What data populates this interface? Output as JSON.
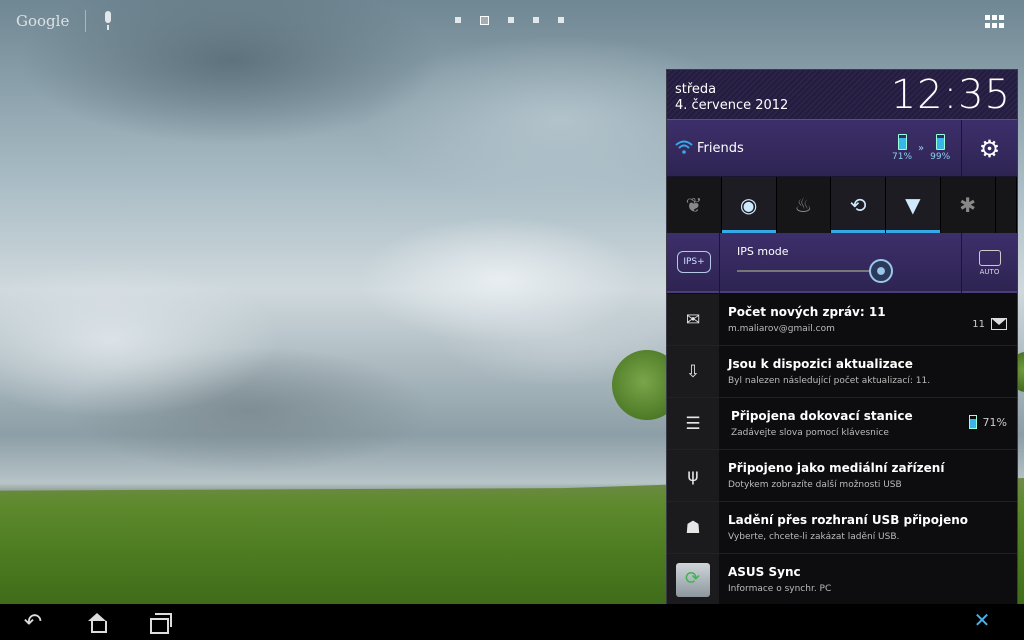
{
  "launcher": {
    "google_label": "Google",
    "page_count": 5,
    "active_page": 2
  },
  "panel": {
    "day": "středa",
    "date": "4. července 2012",
    "time": "12:35",
    "wifi_label": "Friends",
    "battery_tablet": "71%",
    "battery_dock": "99%",
    "battery_separator": "»",
    "toggles": [
      {
        "name": "eco-icon",
        "glyph": "❦",
        "on": false
      },
      {
        "name": "balanced-mode-icon",
        "glyph": "◉",
        "on": true
      },
      {
        "name": "performance-flame-icon",
        "glyph": "♨",
        "on": false
      },
      {
        "name": "auto-rotate-icon",
        "glyph": "⟲",
        "on": true
      },
      {
        "name": "wifi-toggle-icon",
        "glyph": "▼",
        "on": true
      },
      {
        "name": "bluetooth-icon",
        "glyph": "✱",
        "on": false
      }
    ],
    "ips_icon_label": "IPS+",
    "ips_label": "IPS mode",
    "ips_level": 0.9,
    "auto_label": "AUTO"
  },
  "notifications": [
    {
      "title": "Počet nových zpráv: 11",
      "subtitle": "m.maliarov@gmail.com",
      "right": "11",
      "icon": "gmail-icon"
    },
    {
      "title": "Jsou k dispozici aktualizace",
      "subtitle": "Byl nalezen následující počet aktualizací: 11.",
      "right": "",
      "icon": "update-bag-icon"
    },
    {
      "title": "Připojena dokovací stanice",
      "subtitle": "Zadávejte slova pomocí klávesnice",
      "right": "71%",
      "icon": "dock-icon"
    },
    {
      "title": "Připojeno jako mediální zařízení",
      "subtitle": "Dotykem zobrazíte další možnosti USB",
      "right": "",
      "icon": "usb-icon"
    },
    {
      "title": "Ladění přes rozhraní USB připojeno",
      "subtitle": "Vyberte, chcete-li zakázat ladění USB.",
      "right": "",
      "icon": "android-debug-icon"
    },
    {
      "title": "ASUS Sync",
      "subtitle": "Informace o synchr. PC",
      "right": "",
      "icon": "asus-sync-icon"
    }
  ],
  "navbar": {
    "back_glyph": "↶",
    "close_glyph": "✕"
  },
  "colors": {
    "accent": "#36a8e6",
    "panel_purple": "#3d2f6b"
  }
}
